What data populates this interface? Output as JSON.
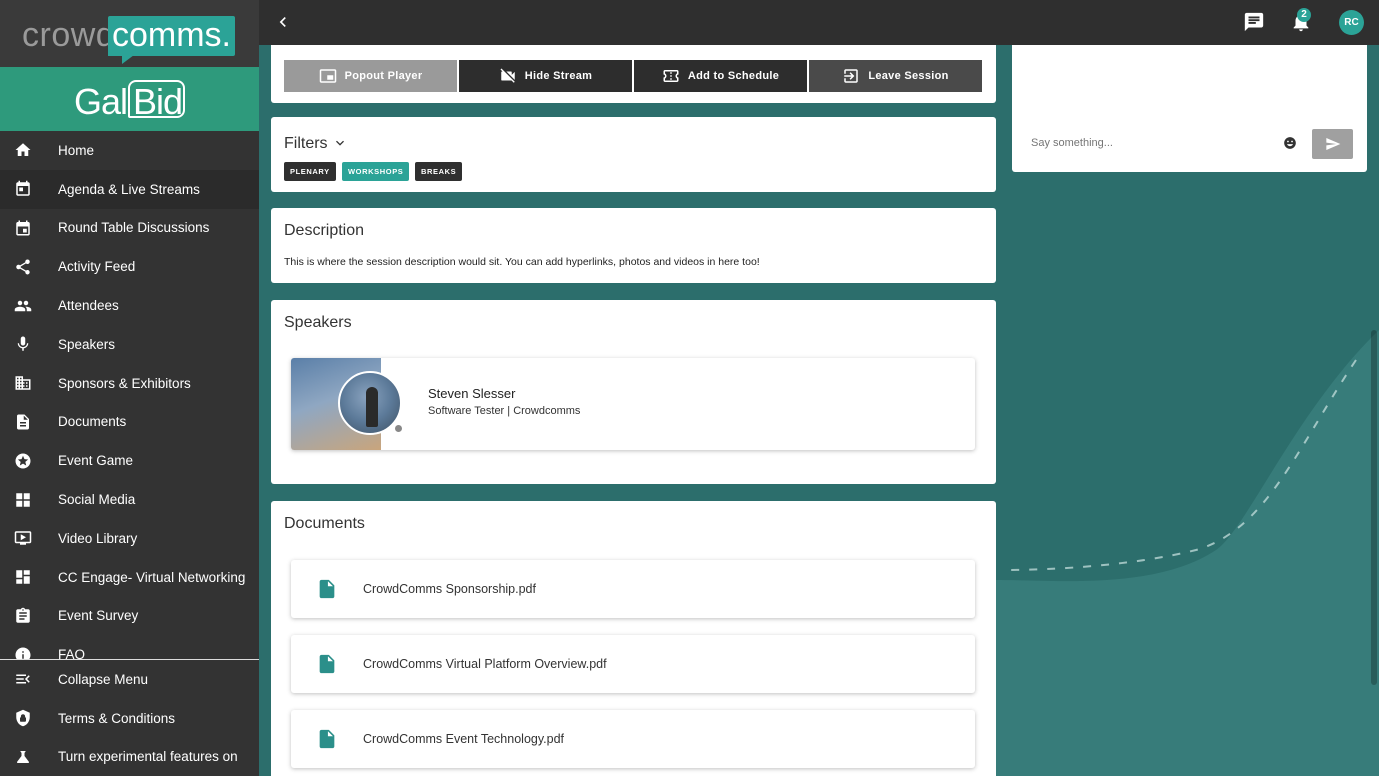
{
  "brand": {
    "logo_part1": "crowd",
    "logo_part2": "comms.",
    "event_logo_part1": "Gala",
    "event_logo_part2": "Bid"
  },
  "sidebar": {
    "items": [
      {
        "label": "Home",
        "icon": "home-icon"
      },
      {
        "label": "Agenda & Live Streams",
        "icon": "agenda-icon",
        "active": true
      },
      {
        "label": "Round Table Discussions",
        "icon": "calendar-icon"
      },
      {
        "label": "Activity Feed",
        "icon": "share-icon"
      },
      {
        "label": "Attendees",
        "icon": "people-icon"
      },
      {
        "label": "Speakers",
        "icon": "microphone-icon"
      },
      {
        "label": "Sponsors & Exhibitors",
        "icon": "building-icon"
      },
      {
        "label": "Documents",
        "icon": "document-icon"
      },
      {
        "label": "Event Game",
        "icon": "star-icon"
      },
      {
        "label": "Social Media",
        "icon": "social-icon"
      },
      {
        "label": "Video Library",
        "icon": "video-library-icon"
      },
      {
        "label": "CC Engage- Virtual Networking",
        "icon": "dashboard-icon"
      },
      {
        "label": "Event Survey",
        "icon": "clipboard-icon"
      },
      {
        "label": "FAQ",
        "icon": "info-icon"
      }
    ],
    "bottom": [
      {
        "label": "Collapse Menu",
        "icon": "collapse-menu-icon"
      },
      {
        "label": "Terms & Conditions",
        "icon": "shield-icon"
      },
      {
        "label": "Turn experimental features on",
        "icon": "flask-icon"
      }
    ]
  },
  "topbar": {
    "notification_count": "2",
    "avatar_initials": "RC"
  },
  "controls": {
    "popout": "Popout Player",
    "hide_stream": "Hide Stream",
    "add_schedule": "Add to Schedule",
    "leave": "Leave Session"
  },
  "filters": {
    "title": "Filters",
    "chips": [
      "PLENARY",
      "WORKSHOPS",
      "BREAKS"
    ]
  },
  "description": {
    "title": "Description",
    "text": "This is where the session description would sit. You can add hyperlinks, photos and videos in here too!"
  },
  "speakers": {
    "title": "Speakers",
    "items": [
      {
        "name": "Steven Slesser",
        "role": "Software Tester | Crowdcomms"
      }
    ]
  },
  "documents": {
    "title": "Documents",
    "items": [
      {
        "name": "CrowdComms Sponsorship.pdf"
      },
      {
        "name": "CrowdComms Virtual Platform Overview.pdf"
      },
      {
        "name": "CrowdComms Event Technology.pdf"
      }
    ]
  },
  "chat": {
    "placeholder": "Say something..."
  },
  "colors": {
    "accent": "#2ba397",
    "sidebar": "#333333",
    "topbar": "#2f2f2f"
  }
}
